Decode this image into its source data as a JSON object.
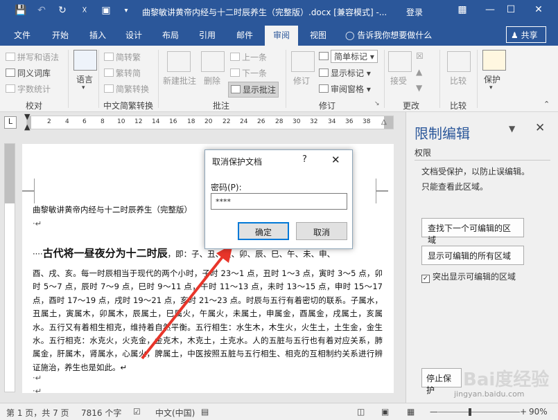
{
  "titlebar": {
    "title": "曲黎敏讲黄帝内经与十二时辰养生（完整版）.docx [兼容模式] -...",
    "login": "登录",
    "quick_access": [
      "save-icon",
      "undo-icon",
      "redo-icon",
      "touch-icon",
      "print-icon",
      "customize-icon"
    ],
    "window_buttons": [
      "ribbon-options-icon",
      "minimize-icon",
      "maximize-icon",
      "close-icon"
    ]
  },
  "tabs": {
    "items": [
      "文件",
      "开始",
      "插入",
      "设计",
      "布局",
      "引用",
      "邮件",
      "审阅",
      "视图"
    ],
    "active": "审阅",
    "tell_me": "告诉我你想要做什么",
    "share": "共享"
  },
  "ribbon": {
    "proofing": {
      "spell": "拼写和语法",
      "thesaurus": "同义词库",
      "wordcount": "字数统计",
      "group": "校对"
    },
    "language": {
      "label": "语言"
    },
    "chinese": {
      "to_trad": "简转繁",
      "to_simp": "繁转简",
      "convert": "简繁转换",
      "group": "中文简繁转换"
    },
    "comments": {
      "new": "新建批注",
      "delete": "删除",
      "prev": "上一条",
      "next": "下一条",
      "show": "显示批注",
      "group": "批注"
    },
    "tracking": {
      "track": "修订",
      "markup": "简单标记",
      "show_markup": "显示标记",
      "pane": "审阅窗格",
      "group": "修订"
    },
    "changes": {
      "accept": "接受",
      "group": "更改"
    },
    "compare": {
      "compare": "比较",
      "group": "比较"
    },
    "protect": {
      "protect": "保护"
    }
  },
  "ruler": {
    "numbers": [
      "2",
      "2",
      "4",
      "6",
      "8",
      "10",
      "12",
      "14",
      "16",
      "18",
      "20",
      "22",
      "24",
      "26",
      "28",
      "30",
      "32",
      "34",
      "36",
      "38"
    ],
    "tab_selector": "L"
  },
  "document": {
    "header_line": "曲黎敏讲黄帝内经与十二时辰养生（完整版）",
    "mark1": "·↵",
    "heading_dots": "····",
    "heading": "古代将一昼夜分为十二时辰",
    "heading_tail": "，即：子、丑、寅、卯、辰、巳、午、未、申、",
    "body": "酉、戌、亥。每一时辰相当于现代的两个小时，子时 23～1 点，丑时 1～3 点，寅时 3～5 点，卯时 5～7 点，辰时 7～9 点，巳时 9～11 点，午时 11～13 点，未时 13～15 点，申时 15～17 点，酉时 17～19 点，戌时 19～21 点，亥时 21～23 点。时辰与五行有着密切的联系。子属水，丑属土，寅属木，卯属木，辰属土，巳属火，午属火，未属土，申属金，酉属金，戌属土，亥属水。五行又有着相生相克，维持着自然平衡。五行相生：水生木，木生火，火生土，土生金，金生水。五行相克：水克火，火克金，金克木，木克土，土克水。人的五脏与五行也有着对应关系，肺属金，肝属木，肾属水，心属火，脾属土，中医按照五脏与五行相生、相克的互相制约关系进行辨证施治，养生也是如此。↵",
    "mark2": "·↵",
    "mark3": "·↵"
  },
  "dialog": {
    "title": "取消保护文档",
    "help": "?",
    "close": "✕",
    "password_label": "密码(P):",
    "password_value": "****",
    "ok": "确定",
    "cancel": "取消"
  },
  "pane": {
    "title": "限制编辑",
    "section": "权限",
    "info1": "文档受保护，以防止误编辑。",
    "info2": "只能查看此区域。",
    "btn_next": "查找下一个可编辑的区域",
    "btn_all": "显示可编辑的所有区域",
    "highlight": "突出显示可编辑的区域",
    "stop": "停止保护"
  },
  "statusbar": {
    "page": "第 1 页，共 7 页",
    "words": "7816 个字",
    "lang": "中文(中国)",
    "zoom": "90%",
    "zoom_level": 0.9
  },
  "watermark": "jingyan.baidu.com",
  "colors": {
    "brand": "#2b579a",
    "arrow": "#e8352a"
  }
}
